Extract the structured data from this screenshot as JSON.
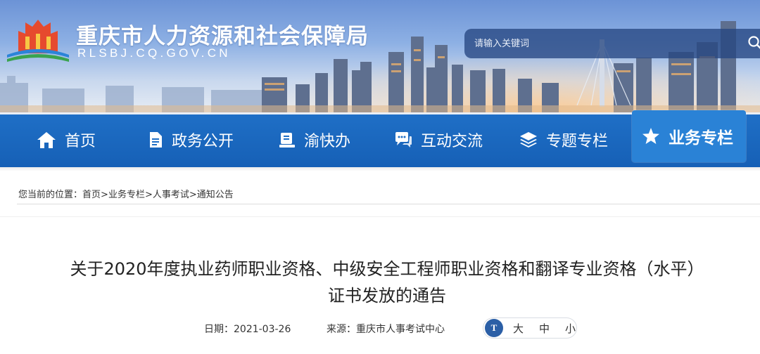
{
  "header": {
    "site_title": "重庆市人力资源和社会保障局",
    "site_domain": "RLSBJ.CQ.GOV.CN",
    "logo_icon": "site-logo-icon"
  },
  "search": {
    "placeholder": "请输入关键词",
    "icon": "search-icon"
  },
  "nav": {
    "items": [
      {
        "label": "首页",
        "icon": "home-icon"
      },
      {
        "label": "政务公开",
        "icon": "document-icon"
      },
      {
        "label": "渝快办",
        "icon": "service-icon"
      },
      {
        "label": "互动交流",
        "icon": "chat-icon"
      },
      {
        "label": "专题专栏",
        "icon": "layers-icon"
      },
      {
        "label": "业务专栏",
        "icon": "star-icon"
      }
    ],
    "active": "业务专栏",
    "colors": {
      "bar": "#1f6fc6",
      "active": "#2a82d6"
    }
  },
  "breadcrumb": {
    "prefix": "您当前的位置：",
    "items": [
      "首页",
      "业务专栏",
      "人事考试",
      "通知公告"
    ],
    "separator": ">"
  },
  "article": {
    "title_line1": "关于2020年度执业药师职业资格、中级安全工程师职业资格和翻译专业资格（水平）",
    "title_line2": "证书发放的通告",
    "date_label": "日期：",
    "date": "2021-03-26",
    "source_label": "来源：",
    "source": "重庆市人事考试中心"
  },
  "font_size_switch": {
    "icon_text": "T",
    "options": [
      "大",
      "中",
      "小"
    ]
  }
}
